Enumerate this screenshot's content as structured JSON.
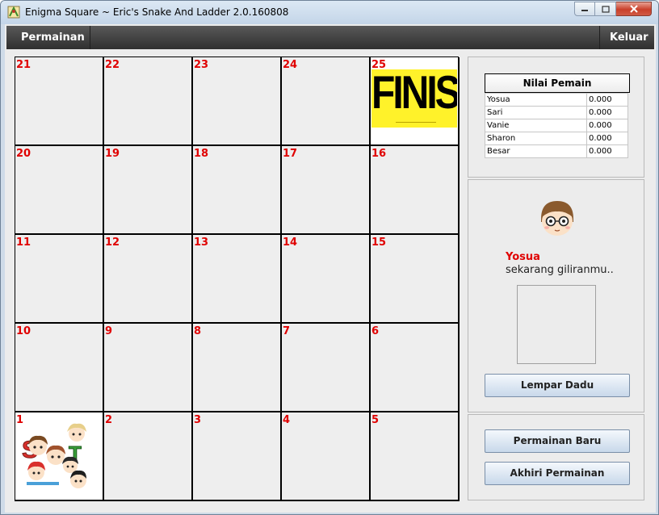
{
  "window": {
    "title": "Enigma Square ~ Eric's Snake And Ladder 2.0.160808"
  },
  "menu": {
    "left": "Permainan",
    "right": "Keluar"
  },
  "board": {
    "rows": [
      [
        "21",
        "22",
        "23",
        "24",
        "25"
      ],
      [
        "20",
        "19",
        "18",
        "17",
        "16"
      ],
      [
        "11",
        "12",
        "13",
        "14",
        "15"
      ],
      [
        "10",
        "9",
        "8",
        "7",
        "6"
      ],
      [
        "1",
        "2",
        "3",
        "4",
        "5"
      ]
    ],
    "finish_text": "FINISH"
  },
  "scoreboard": {
    "title": "Nilai Pemain",
    "players": [
      {
        "name": "Yosua",
        "score": "0.000"
      },
      {
        "name": "Sari",
        "score": "0.000"
      },
      {
        "name": "Vanie",
        "score": "0.000"
      },
      {
        "name": "Sharon",
        "score": "0.000"
      },
      {
        "name": "Besar",
        "score": "0.000"
      }
    ]
  },
  "turn": {
    "player": "Yosua",
    "message": "sekarang giliranmu.."
  },
  "buttons": {
    "roll": "Lempar Dadu",
    "new_game": "Permainan Baru",
    "end_game": "Akhiri Permainan"
  },
  "colors": {
    "cell_number": "#e00000",
    "finish_bg": "#fff22a",
    "menubar": "#3a3a3a"
  }
}
